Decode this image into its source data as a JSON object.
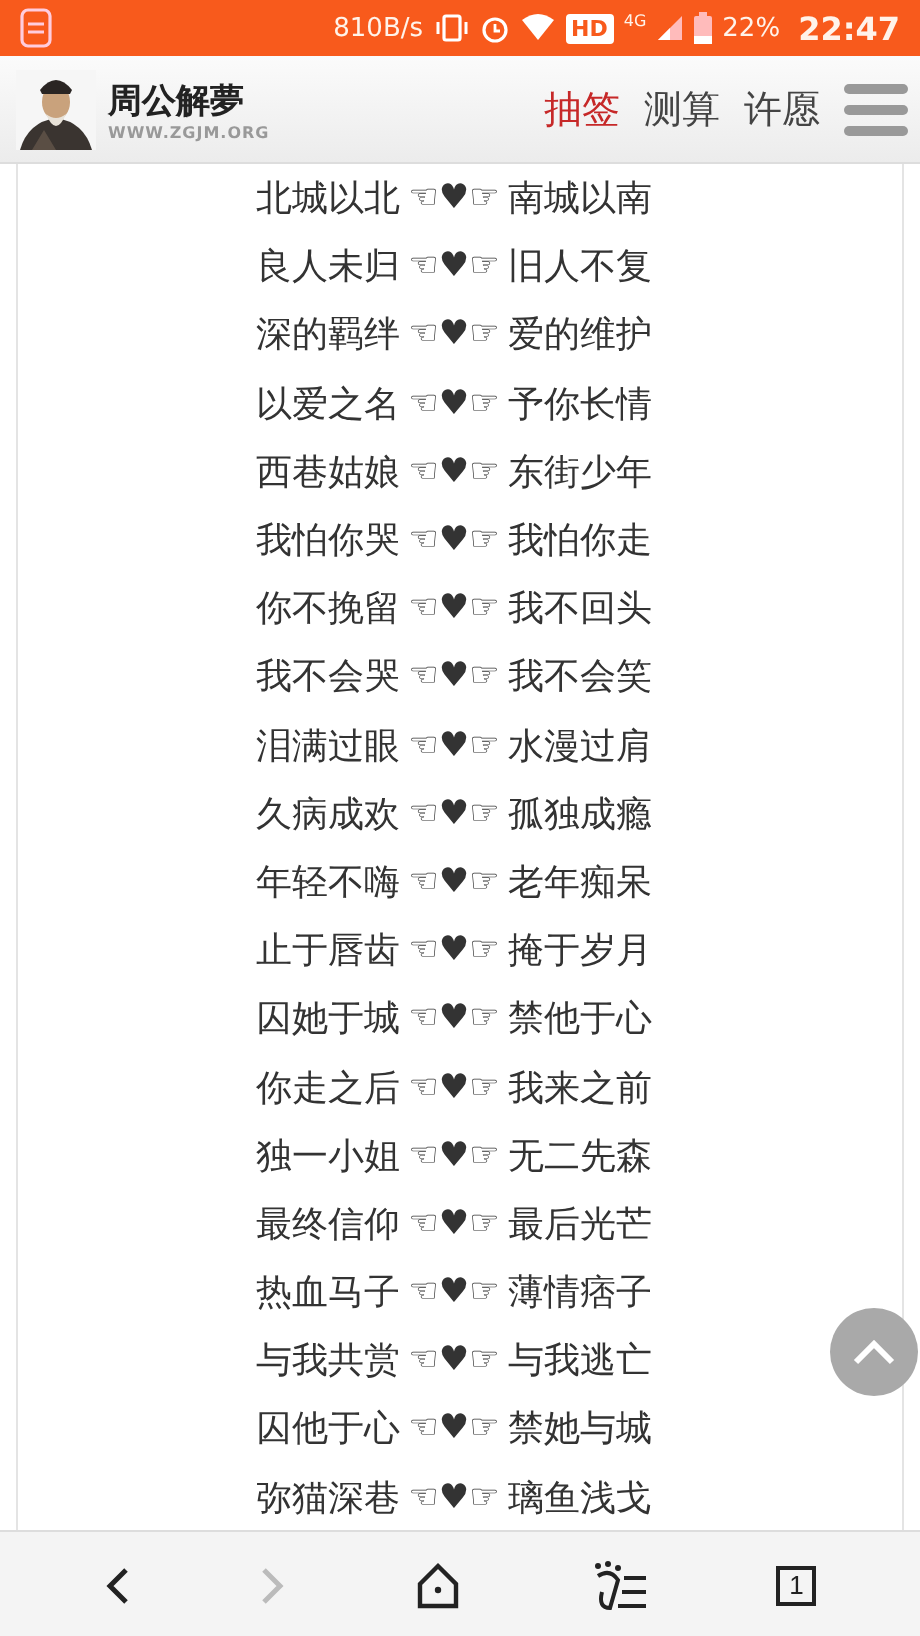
{
  "status_bar": {
    "speed": "810B/s",
    "hd": "HD",
    "network": "4G",
    "battery": "22%",
    "time": "22:47"
  },
  "header": {
    "site_name": "周公解夢",
    "site_url": "WWW.ZGJM.ORG",
    "nav": [
      {
        "label": "抽签",
        "selected": true
      },
      {
        "label": "测算",
        "selected": false
      },
      {
        "label": "许愿",
        "selected": false
      }
    ]
  },
  "rows": [
    {
      "left": "北城以北",
      "middle": "☜♥☞",
      "right": "南城以南"
    },
    {
      "left": "良人未归",
      "middle": "☜♥☞",
      "right": "旧人不复"
    },
    {
      "left": "深的羁绊",
      "middle": "☜♥☞",
      "right": "爱的维护"
    },
    {
      "left": "以爱之名",
      "middle": "☜♥☞",
      "right": "予你长情"
    },
    {
      "left": "西巷姑娘",
      "middle": "☜♥☞",
      "right": "东街少年"
    },
    {
      "left": "我怕你哭",
      "middle": "☜♥☞",
      "right": "我怕你走"
    },
    {
      "left": "你不挽留",
      "middle": "☜♥☞",
      "right": "我不回头"
    },
    {
      "left": "我不会哭",
      "middle": "☜♥☞",
      "right": "我不会笑"
    },
    {
      "left": "泪满过眼",
      "middle": "☜♥☞",
      "right": "水漫过肩"
    },
    {
      "left": "久病成欢",
      "middle": "☜♥☞",
      "right": "孤独成瘾"
    },
    {
      "left": "年轻不嗨",
      "middle": "☜♥☞",
      "right": "老年痴呆"
    },
    {
      "left": "止于唇齿",
      "middle": "☜♥☞",
      "right": "掩于岁月"
    },
    {
      "left": "囚她于城",
      "middle": "☜♥☞",
      "right": "禁他于心"
    },
    {
      "left": "你走之后",
      "middle": "☜♥☞",
      "right": "我来之前"
    },
    {
      "left": "独一小姐",
      "middle": "☜♥☞",
      "right": "无二先森"
    },
    {
      "left": "最终信仰",
      "middle": "☜♥☞",
      "right": "最后光芒"
    },
    {
      "left": "热血马子",
      "middle": "☜♥☞",
      "right": "薄情痞子"
    },
    {
      "left": "与我共赏",
      "middle": "☜♥☞",
      "right": "与我逃亡"
    },
    {
      "left": "囚他于心",
      "middle": "☜♥☞",
      "right": "禁她与城"
    },
    {
      "left": "弥猫深巷",
      "middle": "☜♥☞",
      "right": "璃鱼浅戈"
    }
  ],
  "toolbar": [
    {
      "kind": "back",
      "disabled": false
    },
    {
      "kind": "forward",
      "disabled": true
    },
    {
      "kind": "home",
      "disabled": false
    },
    {
      "kind": "menu",
      "disabled": false
    },
    {
      "kind": "tabs",
      "label": "1",
      "disabled": false
    }
  ]
}
